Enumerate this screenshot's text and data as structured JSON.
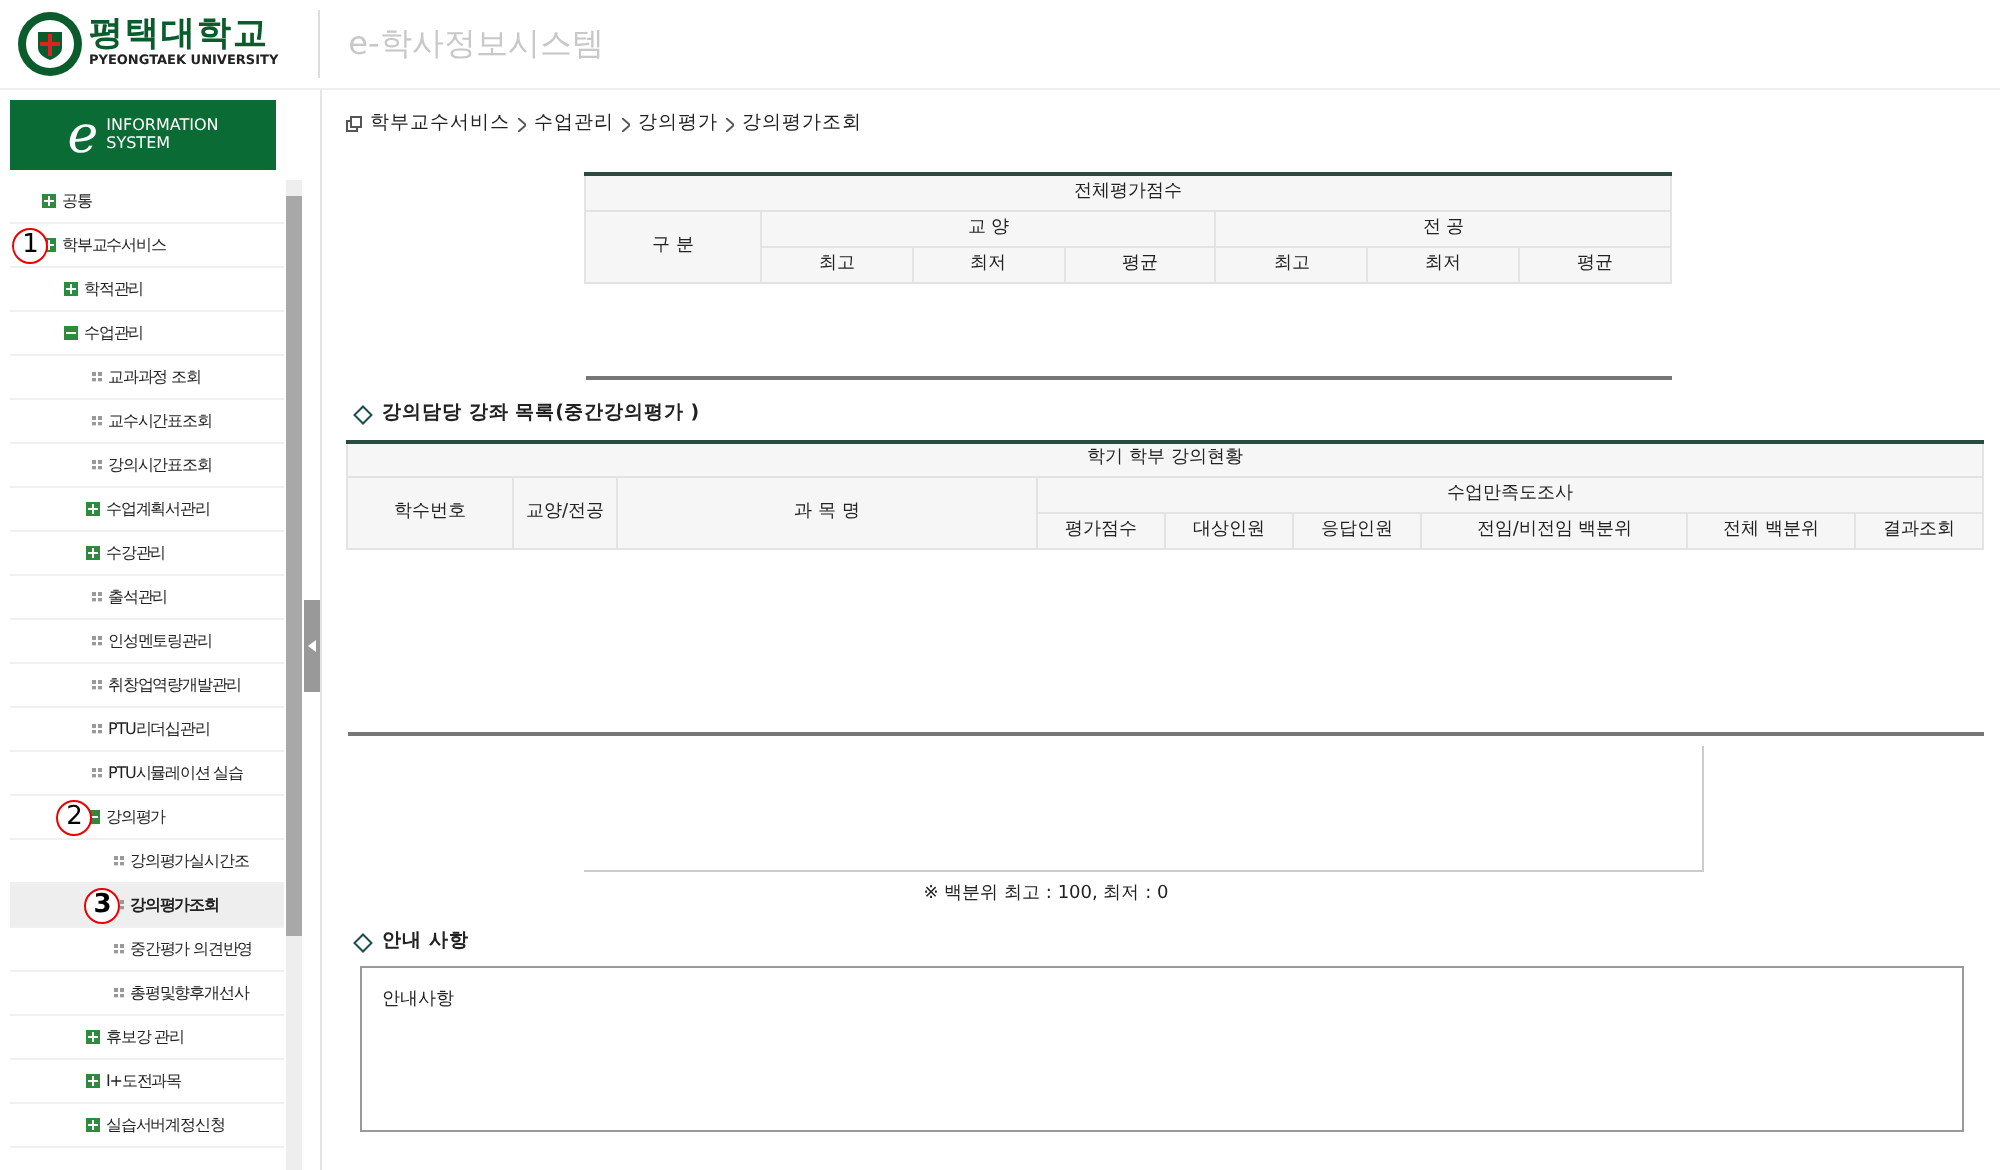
{
  "header": {
    "logo_name": "평택대학교",
    "logo_sub": "PYEONGTAEK UNIVERSITY",
    "system_title": "e-학사정보시스템"
  },
  "sidebar": {
    "banner_letter": "e",
    "banner_line1": "INFORMATION",
    "banner_line2": "SYSTEM",
    "items": [
      {
        "label": "공통",
        "kind": "plus",
        "selected": false
      },
      {
        "label": "학부교수서비스",
        "kind": "plus",
        "selected": false,
        "callout": "1",
        "children": [
          {
            "label": "학적관리",
            "kind": "plus",
            "selected": false
          },
          {
            "label": "수업관리",
            "kind": "minus",
            "selected": false,
            "children": [
              {
                "label": "교과과정 조회",
                "kind": "leaf",
                "selected": false
              },
              {
                "label": "교수시간표조회",
                "kind": "leaf",
                "selected": false
              },
              {
                "label": "강의시간표조회",
                "kind": "leaf",
                "selected": false
              },
              {
                "label": "수업계획서관리",
                "kind": "plus",
                "selected": false
              },
              {
                "label": "수강관리",
                "kind": "plus",
                "selected": false
              },
              {
                "label": "출석관리",
                "kind": "leaf",
                "selected": false
              },
              {
                "label": "인성멘토링관리",
                "kind": "leaf",
                "selected": false
              },
              {
                "label": "취창업역량개발관리",
                "kind": "leaf",
                "selected": false
              },
              {
                "label": "PTU리더십관리",
                "kind": "leaf",
                "selected": false
              },
              {
                "label": "PTU시뮬레이션 실습",
                "kind": "leaf",
                "selected": false
              },
              {
                "label": "강의평가",
                "kind": "minus",
                "selected": false,
                "callout": "2",
                "children": [
                  {
                    "label": "강의평가실시간조",
                    "kind": "leaf",
                    "selected": false
                  },
                  {
                    "label": "강의평가조회",
                    "kind": "leaf",
                    "selected": true,
                    "callout": "3"
                  },
                  {
                    "label": "중간평가 의견반영",
                    "kind": "leaf",
                    "selected": false
                  },
                  {
                    "label": "총평및향후개선사",
                    "kind": "leaf",
                    "selected": false
                  }
                ]
              },
              {
                "label": "휴보강 관리",
                "kind": "plus",
                "selected": false
              },
              {
                "label": "I+도전과목",
                "kind": "plus",
                "selected": false
              },
              {
                "label": "실습서버계정신청",
                "kind": "plus",
                "selected": false
              }
            ]
          }
        ]
      }
    ]
  },
  "breadcrumb": [
    "학부교수서비스",
    "수업관리",
    "강의평가",
    "강의평가조회"
  ],
  "score_table": {
    "title": "전체평가점수",
    "row_header": "구 분",
    "groups": [
      "교 양",
      "전 공"
    ],
    "columns": [
      "최고",
      "최저",
      "평균",
      "최고",
      "최저",
      "평균"
    ]
  },
  "course_section": {
    "title": "강의담당 강좌 목록(중간강의평가 )",
    "table_title": "학기 학부 강의현황",
    "columns": [
      "학수번호",
      "교양/전공",
      "과 목 명"
    ],
    "survey_title": "수업만족도조사",
    "survey_columns": [
      "평가점수",
      "대상인원",
      "응답인원",
      "전임/비전임 백분위",
      "전체 백분위",
      "결과조회"
    ]
  },
  "note": "※ 백분위 최고 : 100, 최저 : 0",
  "notice": {
    "title": "안내 사항",
    "body": "안내사항"
  }
}
